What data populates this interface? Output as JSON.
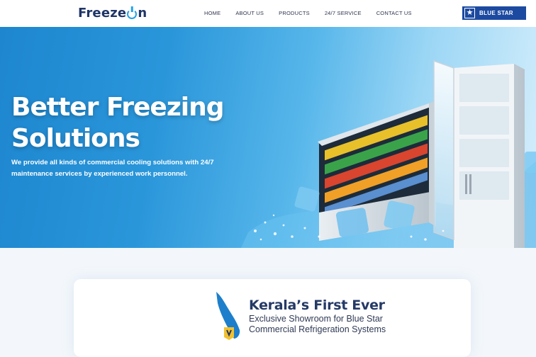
{
  "header": {
    "logo_prefix": "Freeze",
    "logo_suffix": "n",
    "nav": [
      {
        "label": "HOME"
      },
      {
        "label": "ABOUT US"
      },
      {
        "label": "PRODUCTS"
      },
      {
        "label": "24/7 SERVICE"
      },
      {
        "label": "CONTACT US"
      }
    ],
    "partner_brand": "BLUE STAR"
  },
  "hero": {
    "title_line1": "Better Freezing",
    "title_line2": "Solutions",
    "subtitle_line1": "We provide all kinds of commercial cooling solutions with 24/7",
    "subtitle_line2": "maintenance services by experienced work personnel."
  },
  "feature": {
    "heading": "Kerala’s First Ever",
    "line1": "Exclusive Showroom for Blue Star",
    "line2": "Commercial Refrigeration Systems"
  },
  "colors": {
    "brand_navy": "#1f3566",
    "accent_blue": "#24a1e6",
    "partner_blue": "#1c4aa0"
  }
}
